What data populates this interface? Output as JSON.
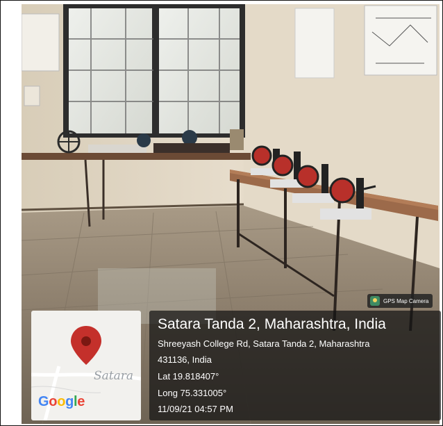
{
  "top_link_text": "",
  "stamp": {
    "badge": {
      "icon": "gps-camera-icon",
      "label": "GPS Map Camera"
    },
    "map": {
      "city_label": "Satara",
      "brand": "Google",
      "pin_icon": "location-pin-icon",
      "pin_color": "#c4302b"
    },
    "place_title": "Satara Tanda 2, Maharashtra, India",
    "address_line1": "Shreeyash College Rd, Satara Tanda 2, Maharashtra",
    "address_line2": "431136, India",
    "latitude": "Lat 19.818407°",
    "longitude": "Long 75.331005°",
    "datetime": "11/09/21 04:57 PM"
  }
}
